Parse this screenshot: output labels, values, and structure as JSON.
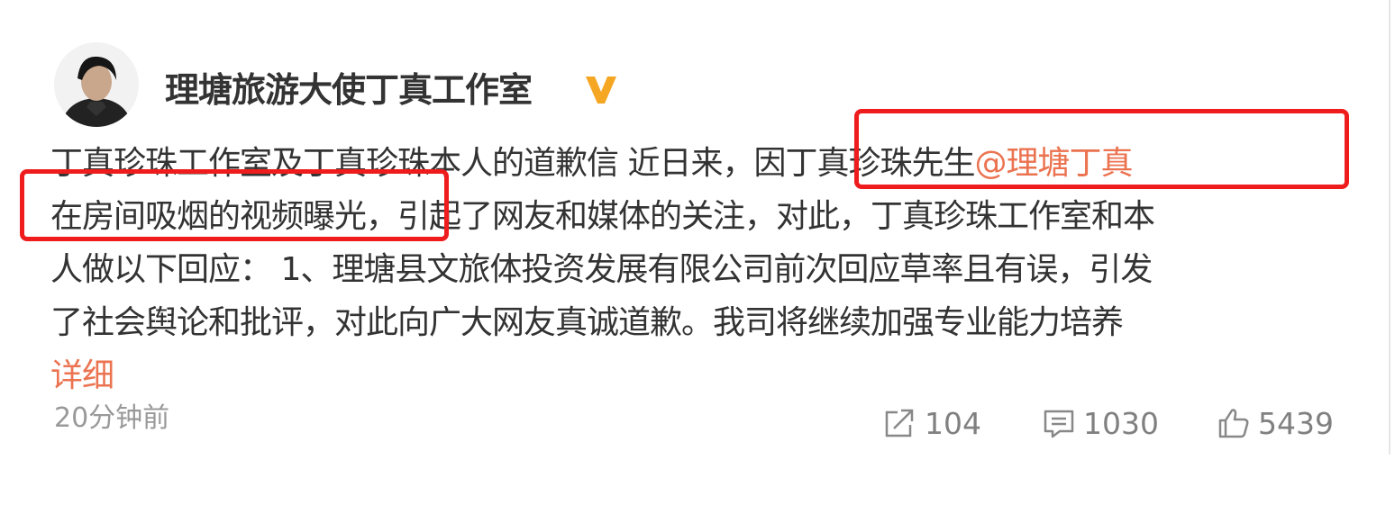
{
  "post": {
    "author": "理塘旅游大使丁真工作室",
    "verified_icon": "verified-v-icon",
    "content_lines": [
      "丁真珍珠工作室及丁真珍珠本人的道歉信 近日来，因丁真珍珠先生",
      "在房间吸烟的视频曝光，引起了网友和媒体的关注，对此，丁真珍珠工作室和本",
      "人做以下回应： 1、理塘县文旅体投资发展有限公司前次回应草率且有误，引发",
      "了社会舆论和批评，对此向广大网友真诚道歉。我司将继续加强专业能力培养"
    ],
    "mention": "@理塘丁真",
    "detail_link": "详细",
    "time": "20分钟前",
    "actions": {
      "repost_icon": "share-icon",
      "repost_count": "104",
      "comment_icon": "comment-icon",
      "comment_count": "1030",
      "like_icon": "thumbs-up-icon",
      "like_count": "5439"
    }
  },
  "colors": {
    "link": "#eb7350",
    "verified": "#f5a623",
    "highlight": "#ee1c1c",
    "meta": "#999999"
  }
}
